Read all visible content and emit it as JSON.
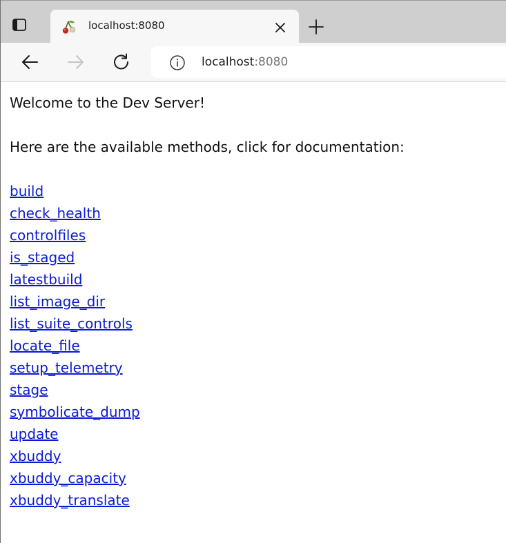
{
  "browser": {
    "tab": {
      "title": "localhost:8080"
    },
    "address_bar": {
      "host": "localhost",
      "port": ":8080"
    },
    "icons": {
      "tab_actions": "tab-actions-icon",
      "favicon": "cherry-favicon-icon",
      "close": "close-icon",
      "new_tab": "plus-icon",
      "back": "back-arrow-icon",
      "forward": "forward-arrow-icon",
      "reload": "reload-icon",
      "site_info": "info-icon"
    }
  },
  "page": {
    "welcome": "Welcome to the Dev Server!",
    "intro": "Here are the available methods, click for documentation:",
    "methods": [
      "build",
      "check_health",
      "controlfiles",
      "is_staged",
      "latestbuild",
      "list_image_dir",
      "list_suite_controls",
      "locate_file",
      "setup_telemetry",
      "stage",
      "symbolicate_dump",
      "update",
      "xbuddy",
      "xbuddy_capacity",
      "xbuddy_translate"
    ],
    "link_color": "#0b1ad6"
  }
}
